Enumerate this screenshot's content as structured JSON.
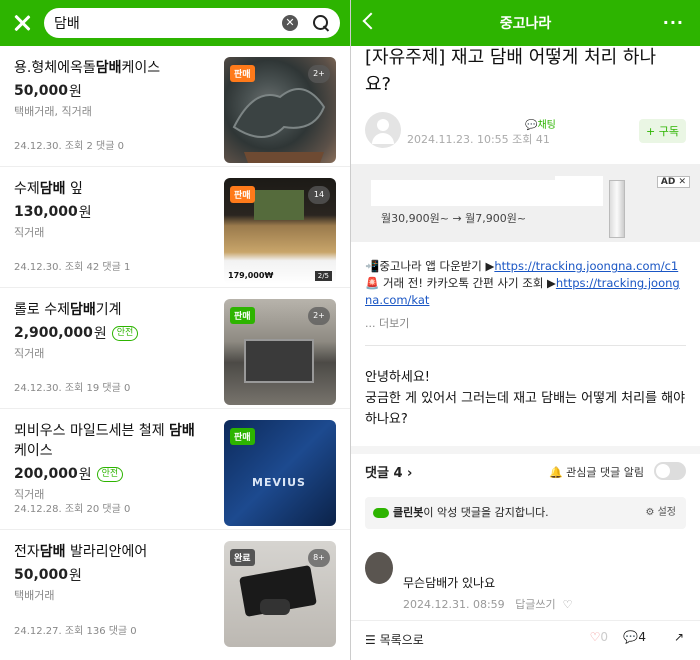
{
  "left": {
    "search": {
      "query": "담배",
      "clear_icon": "clear-circle-icon",
      "search_icon": "search-icon"
    },
    "items": [
      {
        "title_pre": "용.형체에옥돌",
        "title_kw": "담배",
        "title_post": "케이스",
        "price": "50,000",
        "won": "원",
        "safe": "",
        "method": "택배거래, 직거래",
        "meta": "24.12.30.  조회 2  댓글 0",
        "badge": "판매",
        "badge_color": "#ff7a1a",
        "count": "2+"
      },
      {
        "title_pre": "수제",
        "title_kw": "담배",
        "title_post": " 잎",
        "price": "130,000",
        "won": "원",
        "safe": "",
        "method": "직거래",
        "meta": "24.12.30.  조회 42  댓글 1",
        "badge": "판매",
        "badge_color": "#ff7a1a",
        "count": "14",
        "thumb_price": "179,000₩",
        "thumb_page": "2/5"
      },
      {
        "title_pre": "롤로 수제",
        "title_kw": "담배",
        "title_post": "기계",
        "price": "2,900,000",
        "won": "원",
        "safe": "안전",
        "method": "직거래",
        "meta": "24.12.30.  조회 19  댓글 0",
        "badge": "판매",
        "badge_color": "#2db400",
        "count": "2+"
      },
      {
        "title_pre": "뫼비우스 마일드세븐 철제 ",
        "title_kw": "담배",
        "title_post": " 케이스",
        "price": "200,000",
        "won": "원",
        "safe": "안전",
        "method": "직거래",
        "meta": "24.12.28.  조회 20  댓글 0",
        "badge": "판매",
        "badge_color": "#2db400",
        "count": "",
        "thumb_text": "MEVIUS"
      },
      {
        "title_pre": "전자",
        "title_kw": "담배",
        "title_post": " 발라리안에어",
        "price": "50,000",
        "won": "원",
        "safe": "",
        "method": "택배거래",
        "meta": "24.12.27.  조회 136  댓글 0",
        "badge": "완료",
        "badge_color": "#555555",
        "count": "8+"
      }
    ]
  },
  "right": {
    "header": {
      "title": "중고나라",
      "more": "···"
    },
    "post_title": "[자유주제] 재고 담배 어떻게 처리 하나요?",
    "chat_label": "채팅",
    "datetime": "2024.11.23. 10:55  조회 41",
    "subscribe": "+ 구독",
    "ad": {
      "tag": "AD",
      "price": "월30,900원~ → 월7,900원~",
      "close": "✕"
    },
    "links": [
      {
        "prefix": "📲중고나라 앱 다운받기 ▶",
        "url": "https://tracking.joongna.com/c1"
      },
      {
        "prefix": "🚨 거래 전! 카카오톡 간편 사기 조회 ▶",
        "url": "https://tracking.joongna.com/kat"
      }
    ],
    "more_link": "... 더보기",
    "body_greet": "안녕하세요!",
    "body_text": "궁금한 게 있어서 그러는데 재고 담배는 어떻게 처리를 해야하나요?",
    "comments_label": "댓글 4",
    "alert_label": "관심글 댓글 알림",
    "cleanbot": {
      "name": "클린봇",
      "text": "이 악성 댓글을 감지합니다.",
      "settings": "설정"
    },
    "comment": {
      "text": "무슨담배가 있나요",
      "date": "2024.12.31. 08:59",
      "reply": "답글쓰기"
    },
    "bottom": {
      "list": "목록으로",
      "likes": "0",
      "comments": "4"
    }
  }
}
